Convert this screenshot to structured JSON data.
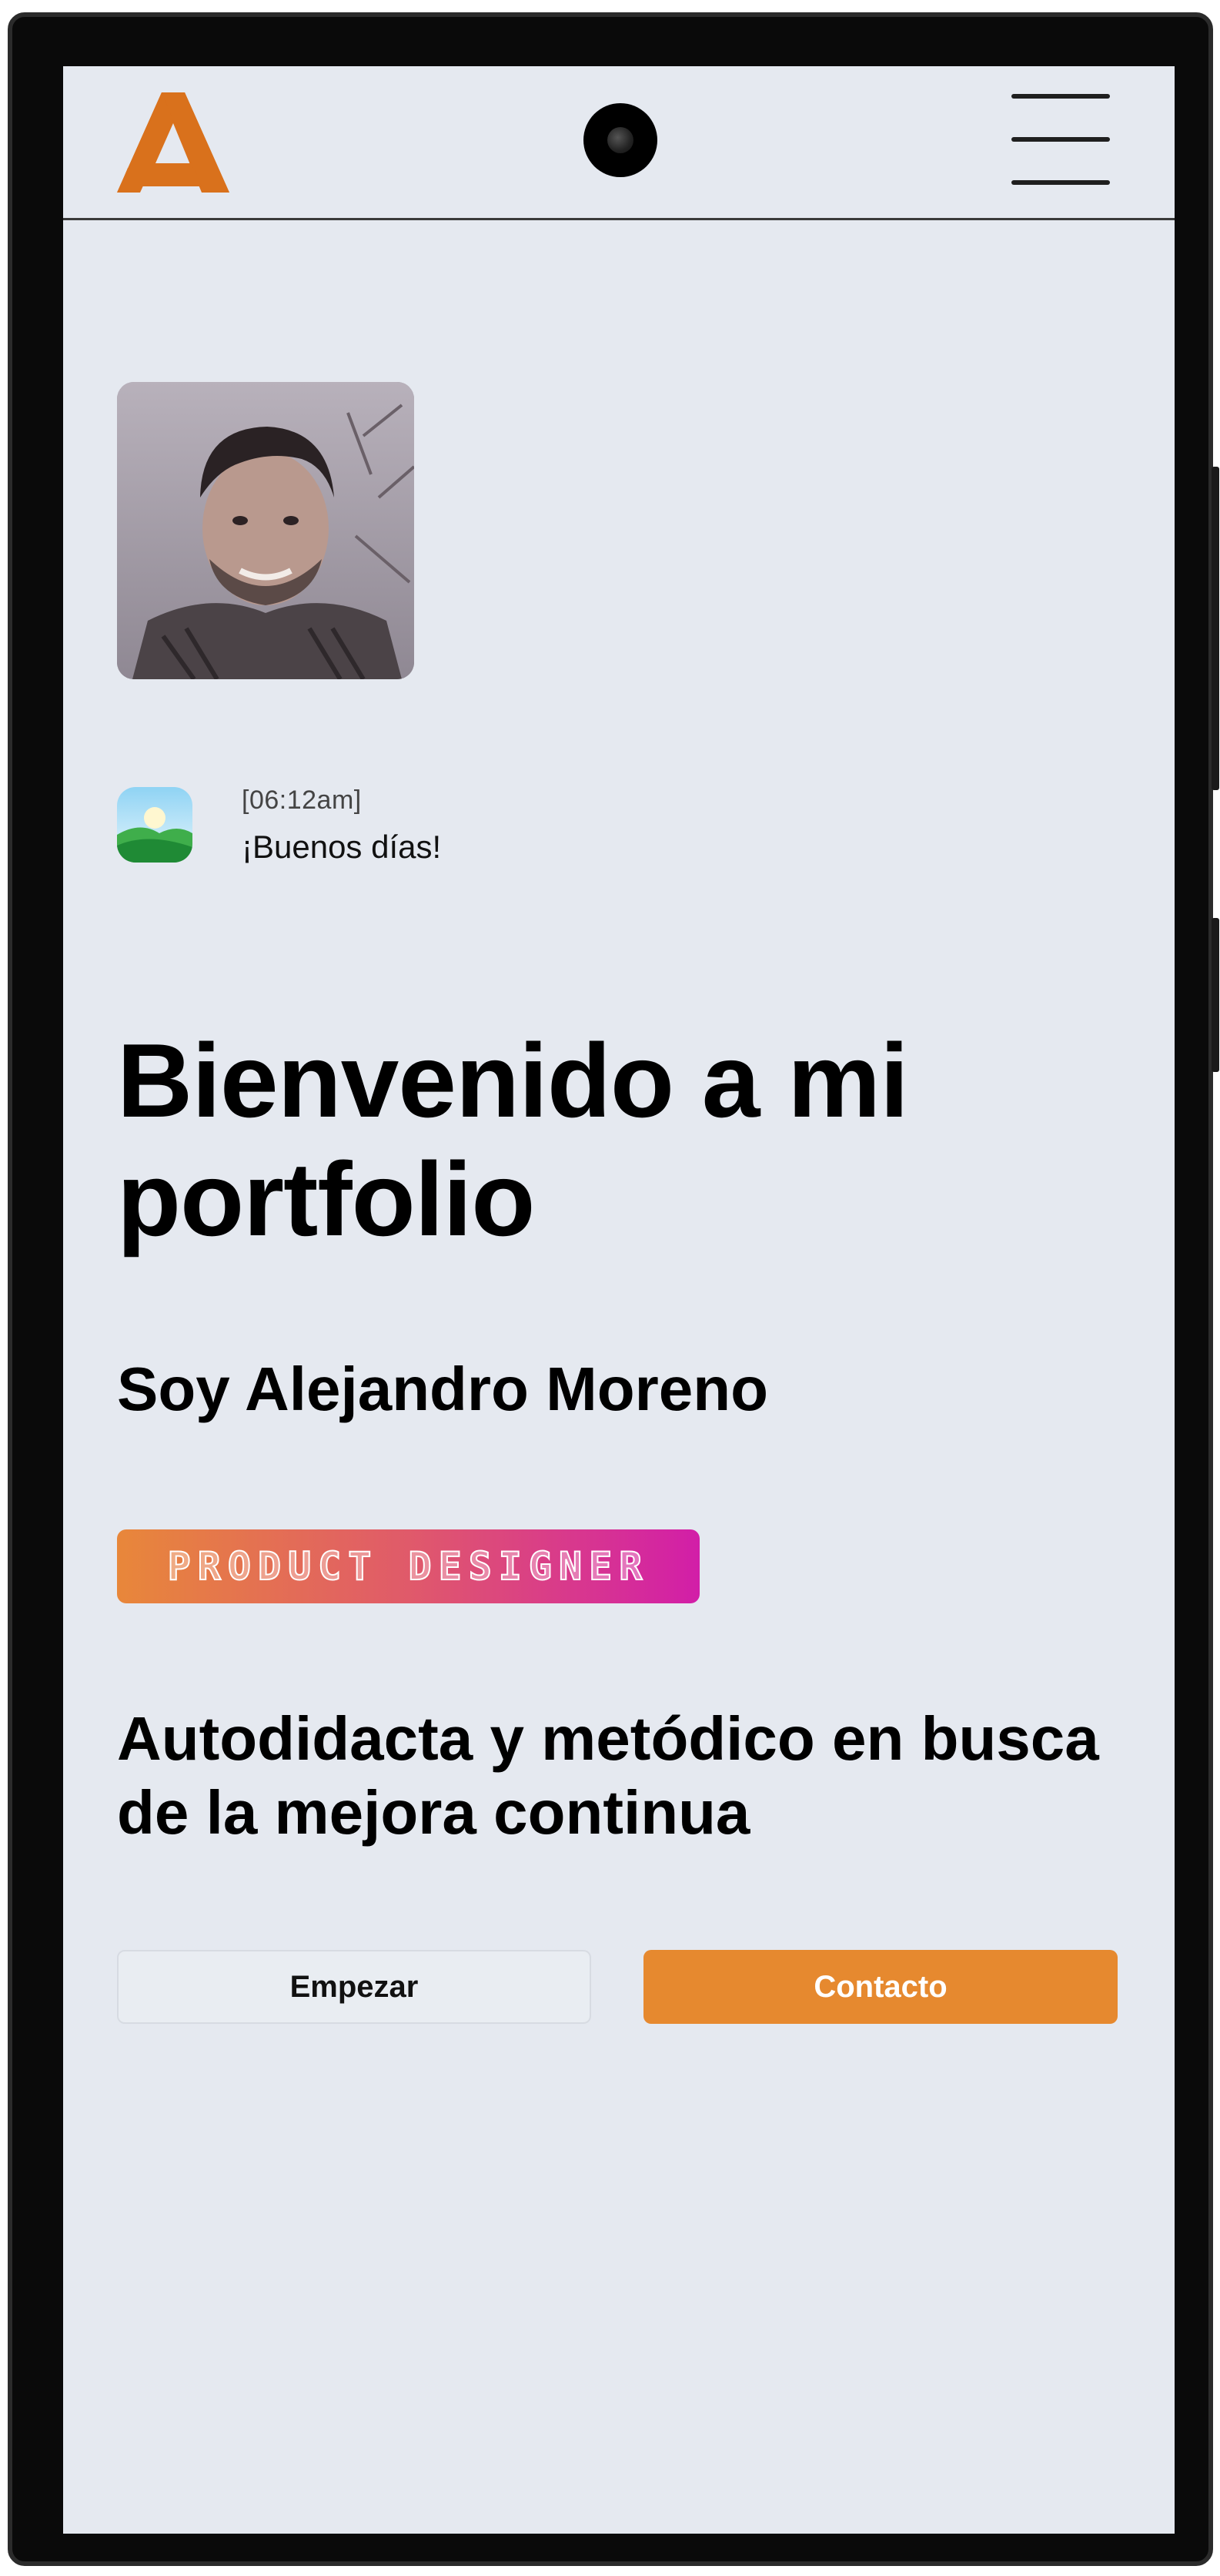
{
  "colors": {
    "screen_bg": "#e5e9f0",
    "accent_orange": "#e6892f",
    "logo_orange": "#d9711c",
    "tag_gradient": [
      "#e8873a",
      "#d21ea8"
    ],
    "text": "#000000"
  },
  "navbar": {
    "logo_icon": "brand-logo-icon",
    "menu_icon": "hamburger-menu-icon"
  },
  "profile": {
    "avatar_icon": "profile-photo"
  },
  "greeting": {
    "icon": "sunrise-landscape-icon",
    "time": "[06:12am]",
    "message": "¡Buenos días!"
  },
  "hero": {
    "title": "Bienvenido a mi portfolio",
    "subtitle": "Soy Alejandro Moreno",
    "tag": "PRODUCT DESIGNER",
    "lead": "Autodidacta y metódico en busca de la mejora continua"
  },
  "actions": {
    "start_label": "Empezar",
    "contact_label": "Contacto"
  }
}
